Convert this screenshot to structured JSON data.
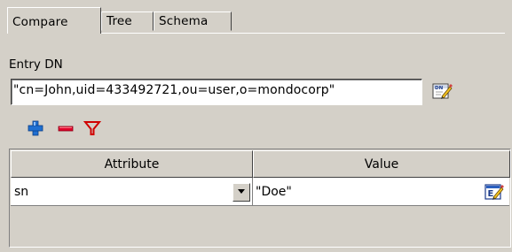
{
  "tabs": [
    {
      "label": "Compare",
      "active": true
    },
    {
      "label": "Tree",
      "active": false
    },
    {
      "label": "Schema",
      "active": false
    }
  ],
  "entry": {
    "label": "Entry DN",
    "value": "\"cn=John,uid=433492721,ou=user,o=mondocorp\""
  },
  "toolbar": {
    "add_icon": "plus-icon",
    "remove_icon": "minus-icon",
    "filter_icon": "filter-icon"
  },
  "table": {
    "columns": [
      "Attribute",
      "Value"
    ],
    "rows": [
      {
        "attribute": "sn",
        "value": "\"Doe\""
      }
    ]
  },
  "colors": {
    "background": "#d4d0c8",
    "add": "#1f6fd1",
    "remove": "#e0002a",
    "filter": "#d00000"
  }
}
